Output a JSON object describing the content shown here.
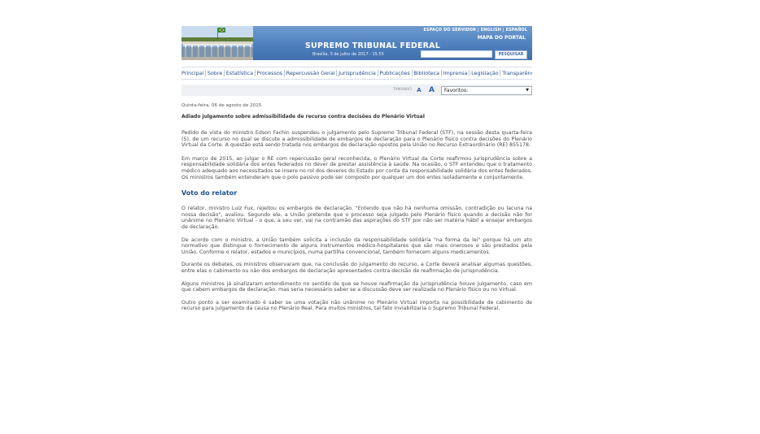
{
  "header": {
    "top_links": [
      "ESPAÇO DO SERVIDOR",
      "ENGLISH",
      "ESPAÑOL"
    ],
    "portal_map": "MAPA DO PORTAL",
    "title": "SUPREMO TRIBUNAL FEDERAL",
    "date": "Brasília, 3 de julho de 2017 - 15:55",
    "search_value": "",
    "search_button": "PESQUISAR",
    "colors": {
      "banner": "#4f80bd",
      "nav_link": "#1f4f8a"
    }
  },
  "nav": {
    "items": [
      "Principal",
      "Sobre",
      "Estatística",
      "Processos",
      "Repercussão Geral",
      "Jurisprudência",
      "Publicações",
      "Biblioteca",
      "Imprensa",
      "Legislação",
      "Transparência"
    ]
  },
  "tools": {
    "size_label": "TAMANHO",
    "font_small": "A",
    "font_large": "A",
    "favorites": "Favoritos:"
  },
  "article": {
    "date": "Quinta-feira, 06 de agosto de 2015",
    "headline": "Adiado julgamento sobre admissibilidade de recurso contra decisões do Plenário Virtual",
    "paragraphs": [
      "Pedido de vista do ministro Edson Fachin suspendeu o julgamento pelo Supremo Tribunal Federal (STF), na sessão desta quarta-feira (5), de um recurso no qual se discute a admissibilidade de embargos de declaração para o Plenário físico contra decisões do Plenário Virtual da Corte. A questão está sendo tratada nos embargos de declaração opostos pela União no Recurso Extraordinário (RE) 855178.",
      "Em março de 2015, ao julgar o RE com repercussão geral reconhecida, o Plenário Virtual da Corte reafirmou jurisprudência sobre a responsabilidade solidária dos entes federados no dever de prestar assistência à saúde. Na ocasião, o STF entendeu que o tratamento médico adequado aos necessitados se insere no rol dos deveres do Estado por conta da responsabilidade solidária dos entes federados. Os ministros também entenderam que o polo passivo pode ser composto por qualquer um dos entes isoladamente e conjuntamente."
    ],
    "section_title": "Voto do relator",
    "section_paragraphs": [
      "O relator, ministro Luiz Fux, rejeitou os embargos de declaração. \"Entendo que não há nenhuma omissão, contradição ou lacuna na nossa decisão\", avaliou. Segundo ele, a União pretende que o processo seja julgado pelo Plenário físico quando a decisão não for unânime no Plenário Virtual - o que, a seu ver, vai na contramão das aspirações do STF por não ser matéria hábil a ensejar embargos de declaração.",
      "De acordo com o ministro, a União também solicita a inclusão da responsabilidade solidária \"na forma da lei\" porque há um ato normativo que distingue o fornecimento de alguns instrumentos médico-hospitalares que são mais onerosos e são prestados pela União. Conforme o relator, estados e municípios, numa partilha convencional, também fornecem alguns medicamentos.",
      "Durante os debates, os ministros observaram que, na conclusão do julgamento do recurso, a Corte deverá analisar algumas questões, entre elas o cabimento ou não dos embargos de declaração apresentados contra decisão de reafirmação de jurisprudência.",
      "Alguns ministros já sinalizaram entendimento no sentido de que se houve reafirmação da jurisprudência houve julgamento, caso em que cabem embargos de declaração, mas seria necessário saber se a discussão deve ser realizada no Plenário físico ou no Virtual.",
      "Outro ponto a ser examinado é saber se uma votação não unânime no Plenário Virtual importa na possibilidade de cabimento de recurso para julgamento da causa no Plenário Real. Para muitos ministros, tal fato inviabilizaria o Supremo Tribunal Federal."
    ]
  }
}
